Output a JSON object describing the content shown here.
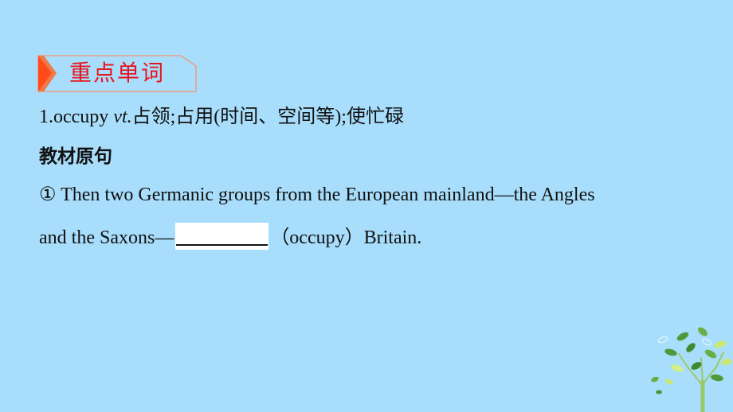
{
  "section_label": "重点单词",
  "entry": {
    "number_word": "1.occupy",
    "pos": "vt.",
    "definition": "占领;占用(时间、空间等);使忙碌"
  },
  "subheading": "教材原句",
  "sentence": {
    "line1": "① Then two Germanic groups from the European mainland—the Angles",
    "line2_before": "and the Saxons—",
    "blank_value": "",
    "line2_after": "（occupy）Britain."
  },
  "colors": {
    "background": "#A8DEFC",
    "label_text": "#E8141C",
    "label_accent": "#FF4A1A",
    "label_border": "#E8A080"
  },
  "icons": {
    "label_arrow": "chevron-flag-icon",
    "decoration": "tree-icon"
  }
}
